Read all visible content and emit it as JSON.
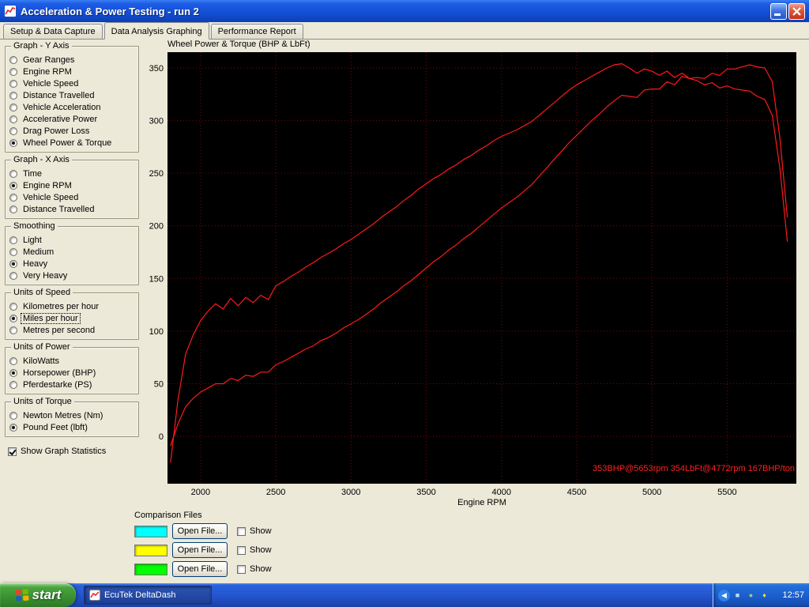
{
  "window": {
    "title": "Acceleration & Power Testing - run 2"
  },
  "tabs": [
    {
      "label": "Setup & Data Capture",
      "active": false
    },
    {
      "label": "Data Analysis Graphing",
      "active": true
    },
    {
      "label": "Performance Report",
      "active": false
    }
  ],
  "panel": {
    "groups": [
      {
        "title": "Graph - Y Axis",
        "options": [
          {
            "label": "Gear Ranges",
            "selected": false
          },
          {
            "label": "Engine RPM",
            "selected": false
          },
          {
            "label": "Vehicle Speed",
            "selected": false
          },
          {
            "label": "Distance Travelled",
            "selected": false
          },
          {
            "label": "Vehicle Acceleration",
            "selected": false
          },
          {
            "label": "Accelerative Power",
            "selected": false
          },
          {
            "label": "Drag Power Loss",
            "selected": false
          },
          {
            "label": "Wheel Power & Torque",
            "selected": true
          }
        ]
      },
      {
        "title": "Graph - X Axis",
        "options": [
          {
            "label": "Time",
            "selected": false
          },
          {
            "label": "Engine RPM",
            "selected": true
          },
          {
            "label": "Vehicle Speed",
            "selected": false
          },
          {
            "label": "Distance Travelled",
            "selected": false
          }
        ]
      },
      {
        "title": "Smoothing",
        "options": [
          {
            "label": "Light",
            "selected": false
          },
          {
            "label": "Medium",
            "selected": false
          },
          {
            "label": "Heavy",
            "selected": true
          },
          {
            "label": "Very Heavy",
            "selected": false
          }
        ]
      },
      {
        "title": "Units of Speed",
        "options": [
          {
            "label": "Kilometres per hour",
            "selected": false
          },
          {
            "label": "Miles per hour",
            "selected": true,
            "focus": true
          },
          {
            "label": "Metres per second",
            "selected": false
          }
        ]
      },
      {
        "title": "Units of Power",
        "options": [
          {
            "label": "KiloWatts",
            "selected": false
          },
          {
            "label": "Horsepower (BHP)",
            "selected": true
          },
          {
            "label": "Pferdestarke (PS)",
            "selected": false
          }
        ]
      },
      {
        "title": "Units of Torque",
        "options": [
          {
            "label": "Newton Metres (Nm)",
            "selected": false
          },
          {
            "label": "Pound Feet (lbft)",
            "selected": true
          }
        ]
      }
    ],
    "stats_checkbox": {
      "label": "Show Graph Statistics",
      "checked": true
    }
  },
  "chart_data": {
    "type": "line",
    "title": "Wheel Power & Torque (BHP & LbFt)",
    "xlabel": "Engine RPM",
    "xticks": [
      2000,
      2500,
      3000,
      3500,
      4000,
      4500,
      5000,
      5500
    ],
    "yticks": [
      0,
      50,
      100,
      150,
      200,
      250,
      300,
      350
    ],
    "xlim": [
      1780,
      5960
    ],
    "ylim": [
      -45,
      365
    ],
    "grid": true,
    "grid_color": "#7a0808",
    "bg": "#000000",
    "line_color": "#ff1a1a",
    "annotation": "353BHP@5653rpm 354LbFt@4772rpm 167BHP/ton",
    "annotation_color": "#ff2020",
    "x": [
      1800,
      1850,
      1900,
      1950,
      2000,
      2050,
      2100,
      2150,
      2200,
      2250,
      2300,
      2350,
      2400,
      2450,
      2500,
      2550,
      2600,
      2650,
      2700,
      2750,
      2800,
      2850,
      2900,
      2950,
      3000,
      3050,
      3100,
      3150,
      3200,
      3250,
      3300,
      3350,
      3400,
      3450,
      3500,
      3550,
      3600,
      3650,
      3700,
      3750,
      3800,
      3850,
      3900,
      3950,
      4000,
      4050,
      4100,
      4150,
      4200,
      4250,
      4300,
      4350,
      4400,
      4450,
      4500,
      4550,
      4600,
      4650,
      4700,
      4750,
      4800,
      4850,
      4900,
      4950,
      5000,
      5050,
      5100,
      5150,
      5200,
      5250,
      5300,
      5350,
      5400,
      5450,
      5500,
      5550,
      5600,
      5650,
      5700,
      5750,
      5800,
      5850,
      5900
    ],
    "series": [
      {
        "name": "Wheel Torque (LbFt)",
        "color": "#ff1a1a",
        "values": [
          -25,
          35,
          78,
          96,
          110,
          119,
          126,
          121,
          131,
          124,
          132,
          127,
          134,
          130,
          143,
          147,
          152,
          156,
          161,
          165,
          170,
          174,
          178,
          183,
          187,
          192,
          197,
          202,
          208,
          213,
          218,
          224,
          229,
          235,
          240,
          245,
          249,
          254,
          258,
          263,
          267,
          272,
          276,
          281,
          285,
          288,
          291,
          295,
          299,
          305,
          311,
          317,
          323,
          329,
          334,
          338,
          342,
          346,
          350,
          353,
          354,
          350,
          345,
          349,
          347,
          343,
          347,
          341,
          345,
          340,
          338,
          334,
          336,
          331,
          333,
          330,
          329,
          328,
          323,
          320,
          305,
          255,
          185
        ]
      },
      {
        "name": "Wheel Power (BHP)",
        "color": "#ff1a1a",
        "values": [
          -9,
          12,
          28,
          36,
          42,
          46,
          50,
          50,
          55,
          53,
          58,
          57,
          61,
          61,
          68,
          71,
          75,
          79,
          83,
          86,
          91,
          94,
          98,
          103,
          107,
          111,
          116,
          121,
          127,
          132,
          137,
          143,
          148,
          154,
          160,
          166,
          171,
          177,
          182,
          188,
          193,
          199,
          205,
          211,
          217,
          222,
          227,
          233,
          239,
          247,
          255,
          263,
          271,
          279,
          286,
          293,
          300,
          306,
          313,
          319,
          324,
          323,
          322,
          329,
          330,
          330,
          337,
          334,
          342,
          340,
          341,
          340,
          345,
          343,
          349,
          349,
          351,
          353,
          351,
          350,
          337,
          284,
          208
        ]
      }
    ],
    "peak_power_bhp": 353,
    "peak_power_rpm": 5653,
    "peak_torque_lbft": 354,
    "peak_torque_rpm": 4772,
    "power_to_weight_bhp_per_ton": 167
  },
  "comparison": {
    "title": "Comparison Files",
    "rows": [
      {
        "color": "#00ffff",
        "button": "Open File...",
        "show": "Show",
        "checked": false
      },
      {
        "color": "#ffff00",
        "button": "Open File...",
        "show": "Show",
        "checked": false
      },
      {
        "color": "#00ff00",
        "button": "Open File...",
        "show": "Show",
        "checked": false
      }
    ]
  },
  "taskbar": {
    "start": "start",
    "task": "EcuTek DeltaDash",
    "clock": "12:57",
    "tray_icons": [
      {
        "name": "hide-icons-chevron-icon",
        "glyph": "◀",
        "bg": "#2f80e8",
        "shape": "circle",
        "fg": "#ffffff"
      },
      {
        "name": "network-status-icon",
        "glyph": "■",
        "bg": "transparent",
        "fg": "#c4d8fa"
      },
      {
        "name": "antivirus-icon",
        "glyph": "●",
        "bg": "transparent",
        "fg": "#8fd08f"
      },
      {
        "name": "volume-icon",
        "glyph": "♦",
        "bg": "transparent",
        "fg": "#f2cf5a"
      }
    ]
  }
}
